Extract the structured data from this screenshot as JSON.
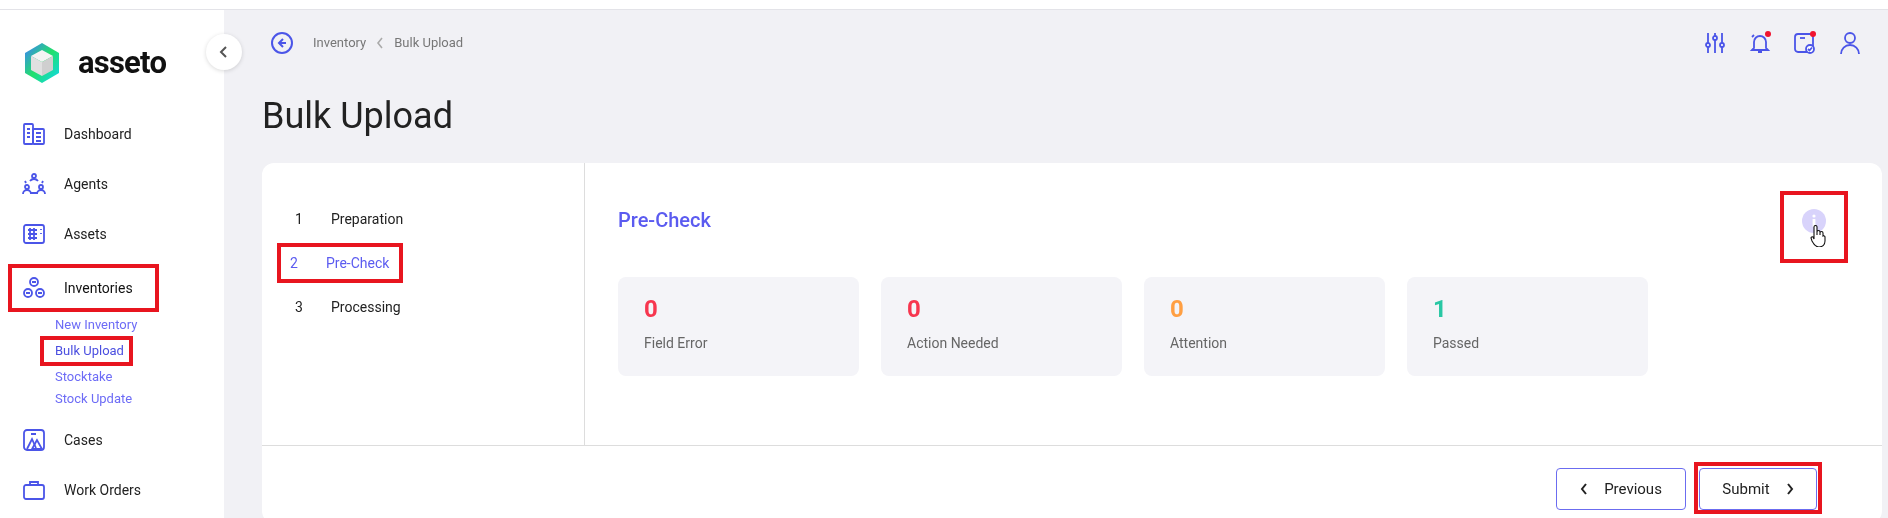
{
  "brand": {
    "name": "asseto"
  },
  "sidebar": {
    "items": [
      {
        "label": "Dashboard",
        "kind": "building",
        "selected": false,
        "highlighted": false
      },
      {
        "label": "Agents",
        "kind": "people",
        "selected": false,
        "highlighted": false
      },
      {
        "label": "Assets",
        "kind": "board",
        "selected": false,
        "highlighted": false
      },
      {
        "label": "Inventories",
        "kind": "circles",
        "selected": true,
        "highlighted": true,
        "children": [
          {
            "label": "New Inventory",
            "selected": false,
            "highlighted": false
          },
          {
            "label": "Bulk Upload",
            "selected": true,
            "highlighted": true
          },
          {
            "label": "Stocktake",
            "selected": false,
            "highlighted": false
          },
          {
            "label": "Stock Update",
            "selected": false,
            "highlighted": false
          }
        ]
      },
      {
        "label": "Cases",
        "kind": "case",
        "selected": false,
        "highlighted": false
      },
      {
        "label": "Work Orders",
        "kind": "briefcase",
        "selected": false,
        "highlighted": false
      }
    ]
  },
  "breadcrumb": [
    "Inventory",
    "Bulk Upload"
  ],
  "header_icons": [
    {
      "kind": "sliders",
      "badge": false
    },
    {
      "kind": "bell",
      "badge": true
    },
    {
      "kind": "calendar",
      "badge": true
    },
    {
      "kind": "user",
      "badge": false
    }
  ],
  "page_title": "Bulk Upload",
  "steps": [
    {
      "number": "1",
      "label": "Preparation",
      "selected": false,
      "highlighted": false
    },
    {
      "number": "2",
      "label": "Pre-Check",
      "selected": true,
      "highlighted": true
    },
    {
      "number": "3",
      "label": "Processing",
      "selected": false,
      "highlighted": false
    }
  ],
  "section_title": "Pre-Check",
  "info_button": {
    "highlighted": true
  },
  "stats": [
    {
      "value": "0",
      "label": "Field Error",
      "color": "#f7364f"
    },
    {
      "value": "0",
      "label": "Action Needed",
      "color": "#f7364f"
    },
    {
      "value": "0",
      "label": "Attention",
      "color": "#ff9f43"
    },
    {
      "value": "1",
      "label": "Passed",
      "color": "#28c7a4"
    }
  ],
  "buttons": [
    {
      "kind": "back",
      "label": "Previous",
      "highlighted": false
    },
    {
      "kind": "next",
      "label": "Submit",
      "highlighted": true
    }
  ]
}
